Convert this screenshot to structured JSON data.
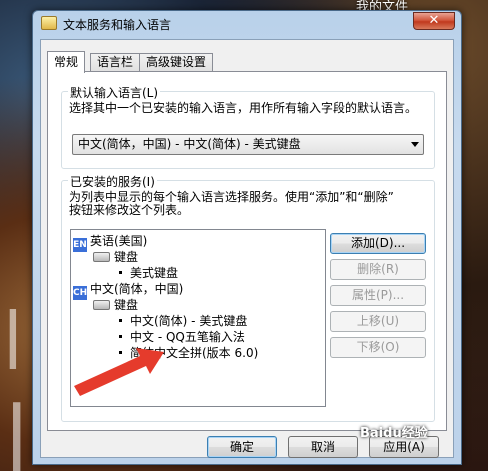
{
  "desktop": {
    "top_label": "我的文件",
    "watermark": "Baidu经验"
  },
  "dialog": {
    "title": "文本服务和输入语言",
    "close_symbol": "✕",
    "tabs": [
      {
        "label": "常规",
        "active": true
      },
      {
        "label": "语言栏",
        "active": false
      },
      {
        "label": "高级键设置",
        "active": false
      }
    ],
    "default_language": {
      "legend": "默认输入语言(L)",
      "description": "选择其中一个已安装的输入语言，用作所有输入字段的默认语言。",
      "selected": "中文(简体，中国) - 中文(简体) - 美式键盘"
    },
    "installed_services": {
      "legend": "已安装的服务(I)",
      "description_line1": "为列表中显示的每个输入语言选择服务。使用“添加”和“删除”",
      "description_line2": "按钮来修改这个列表。",
      "tree": [
        {
          "level": 0,
          "badge": "EN",
          "label": "英语(美国)"
        },
        {
          "level": 1,
          "label": "键盘"
        },
        {
          "level": 2,
          "label": "美式键盘"
        },
        {
          "level": 0,
          "badge": "CH",
          "label": "中文(简体，中国)"
        },
        {
          "level": 1,
          "label": "键盘"
        },
        {
          "level": 2,
          "label": "中文(简体) - 美式键盘"
        },
        {
          "level": 2,
          "label": "中文 - QQ五笔输入法"
        },
        {
          "level": 2,
          "label": "简体中文全拼(版本 6.0)"
        }
      ],
      "buttons": {
        "add": "添加(D)...",
        "remove": "删除(R)",
        "properties": "属性(P)...",
        "move_up": "上移(U)",
        "move_down": "下移(O)"
      }
    },
    "footer": {
      "ok": "确定",
      "cancel": "取消",
      "apply": "应用(A)"
    }
  },
  "colors": {
    "annotation_arrow": "#e53b2c",
    "language_badge": "#3a6fd8"
  }
}
